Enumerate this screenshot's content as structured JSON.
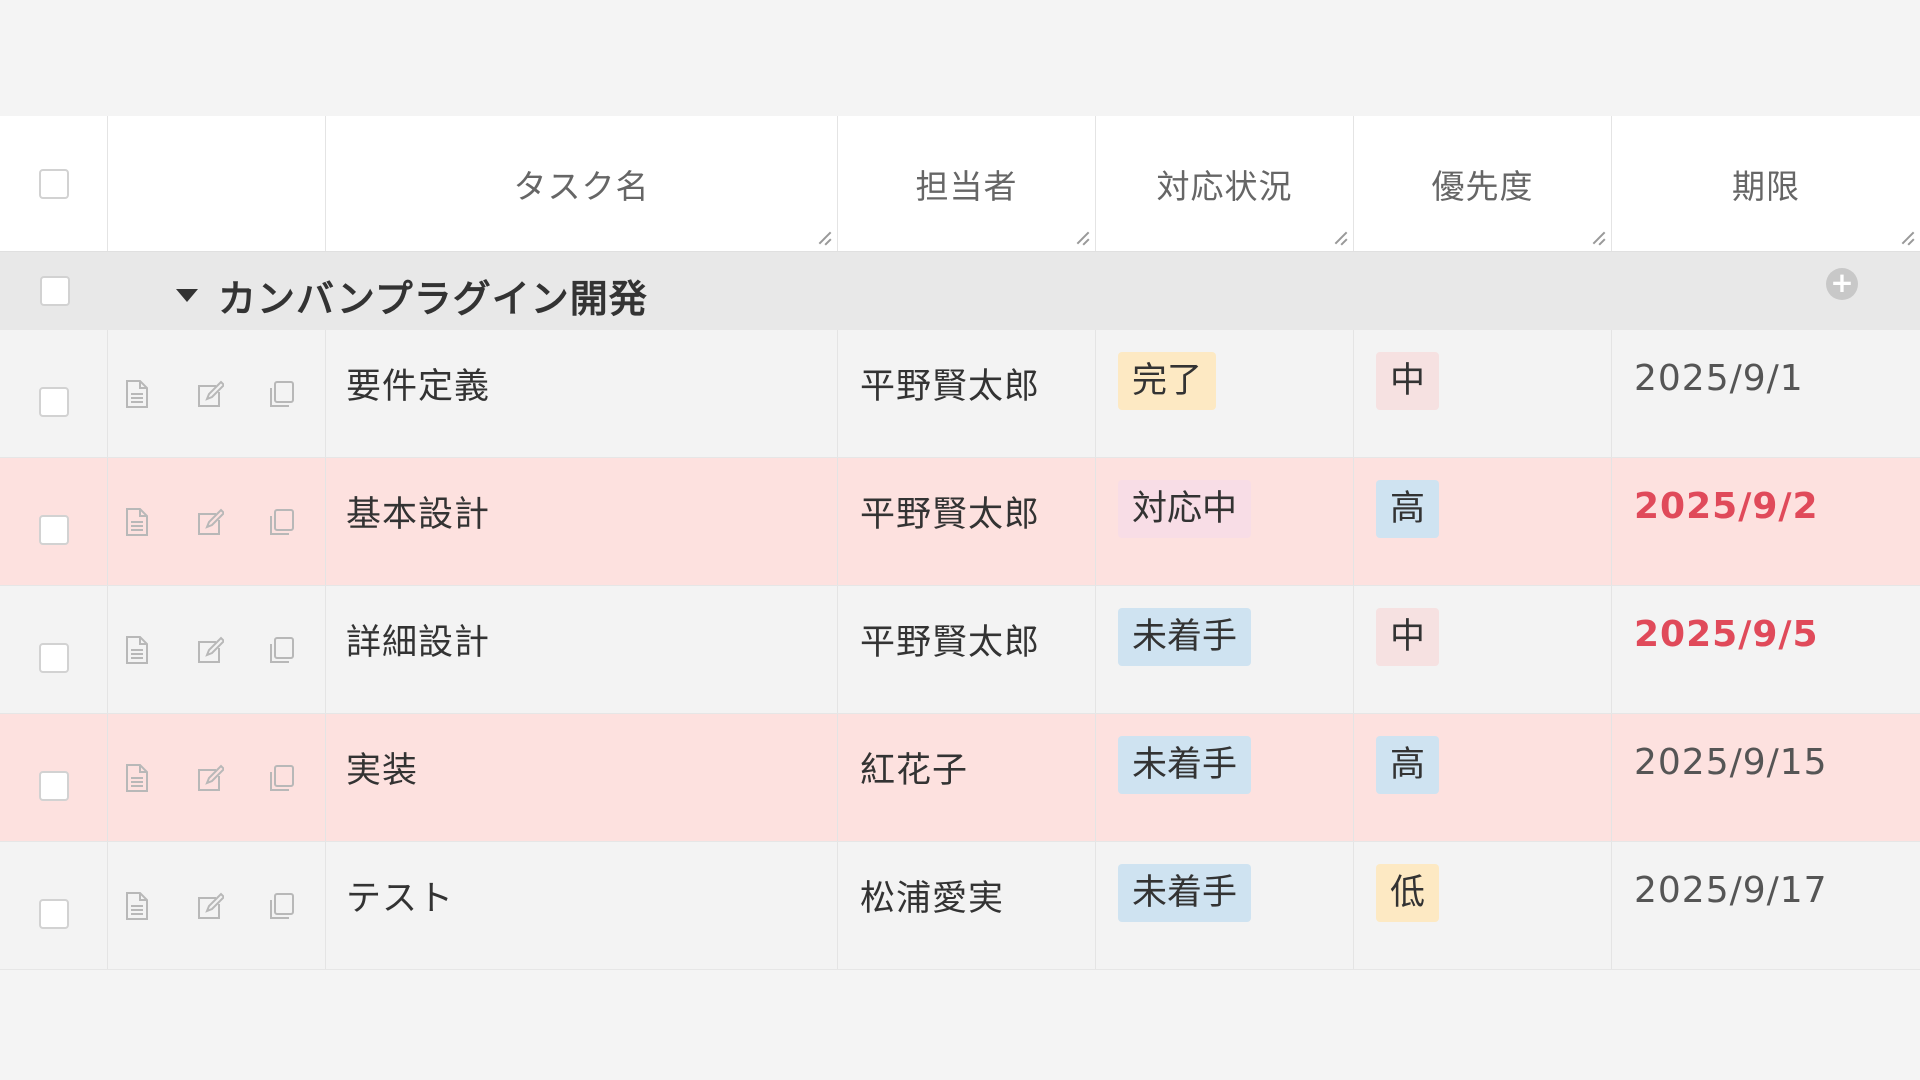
{
  "header": {
    "columns": [
      "タスク名",
      "担当者",
      "対応状況",
      "優先度",
      "期限"
    ]
  },
  "group": {
    "title": "カンバンプラグイン開発",
    "add_icon": "plus-circle-icon"
  },
  "colors": {
    "alert_row": "#fde1df",
    "overdue_date": "#e04a5a"
  },
  "rows": [
    {
      "name": "要件定義",
      "assignee": "平野賢太郎",
      "status": {
        "label": "完了",
        "color": "#fde9c3"
      },
      "priority": {
        "label": "中",
        "color": "#f6e1e1"
      },
      "due": "2025/9/1",
      "overdue": false,
      "highlight": false
    },
    {
      "name": "基本設計",
      "assignee": "平野賢太郎",
      "status": {
        "label": "対応中",
        "color": "#f8dde6"
      },
      "priority": {
        "label": "高",
        "color": "#cfe3f1"
      },
      "due": "2025/9/2",
      "overdue": true,
      "highlight": true
    },
    {
      "name": "詳細設計",
      "assignee": "平野賢太郎",
      "status": {
        "label": "未着手",
        "color": "#cfe3f1"
      },
      "priority": {
        "label": "中",
        "color": "#f6e1e1"
      },
      "due": "2025/9/5",
      "overdue": true,
      "highlight": false
    },
    {
      "name": "実装",
      "assignee": "紅花子",
      "status": {
        "label": "未着手",
        "color": "#cfe3f1"
      },
      "priority": {
        "label": "高",
        "color": "#cfe3f1"
      },
      "due": "2025/9/15",
      "overdue": false,
      "highlight": true
    },
    {
      "name": "テスト",
      "assignee": "松浦愛実",
      "status": {
        "label": "未着手",
        "color": "#cfe3f1"
      },
      "priority": {
        "label": "低",
        "color": "#fde9c3"
      },
      "due": "2025/9/17",
      "overdue": false,
      "highlight": false
    }
  ]
}
